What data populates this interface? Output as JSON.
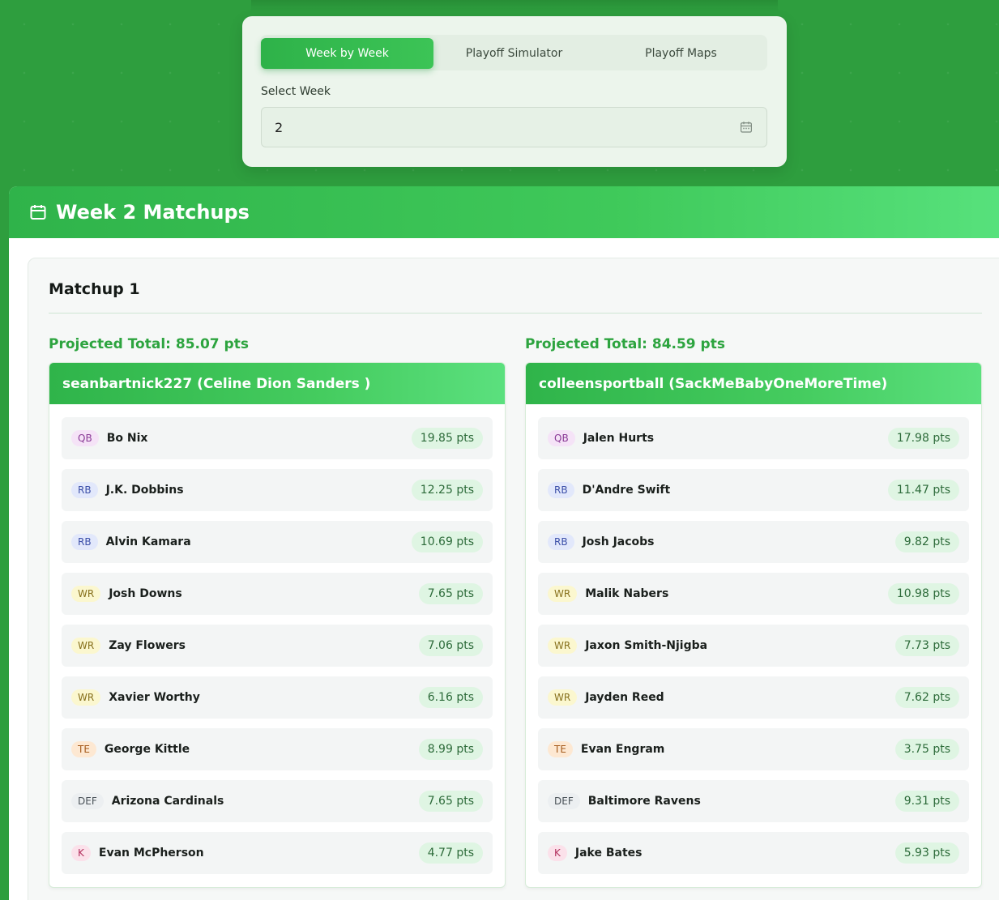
{
  "tabs": [
    {
      "label": "Week by Week",
      "active": true
    },
    {
      "label": "Playoff Simulator",
      "active": false
    },
    {
      "label": "Playoff Maps",
      "active": false
    }
  ],
  "week_select": {
    "label": "Select Week",
    "value": "2",
    "icon": "calendar-icon"
  },
  "panel": {
    "title": "Week 2 Matchups",
    "icon": "calendar-icon"
  },
  "matchup": {
    "title": "Matchup 1",
    "teams": [
      {
        "projected": "Projected Total: 85.07 pts",
        "name": "seanbartnick227 (Celine Dion Sanders )",
        "players": [
          {
            "pos": "QB",
            "name": "Bo Nix",
            "pts": "19.85 pts"
          },
          {
            "pos": "RB",
            "name": "J.K. Dobbins",
            "pts": "12.25 pts"
          },
          {
            "pos": "RB",
            "name": "Alvin Kamara",
            "pts": "10.69 pts"
          },
          {
            "pos": "WR",
            "name": "Josh Downs",
            "pts": "7.65 pts"
          },
          {
            "pos": "WR",
            "name": "Zay Flowers",
            "pts": "7.06 pts"
          },
          {
            "pos": "WR",
            "name": "Xavier Worthy",
            "pts": "6.16 pts"
          },
          {
            "pos": "TE",
            "name": "George Kittle",
            "pts": "8.99 pts"
          },
          {
            "pos": "DEF",
            "name": "Arizona Cardinals",
            "pts": "7.65 pts"
          },
          {
            "pos": "K",
            "name": "Evan McPherson",
            "pts": "4.77 pts"
          }
        ]
      },
      {
        "projected": "Projected Total: 84.59 pts",
        "name": "colleensportball (SackMeBabyOneMoreTime)",
        "players": [
          {
            "pos": "QB",
            "name": "Jalen Hurts",
            "pts": "17.98 pts"
          },
          {
            "pos": "RB",
            "name": "D'Andre Swift",
            "pts": "11.47 pts"
          },
          {
            "pos": "RB",
            "name": "Josh Jacobs",
            "pts": "9.82 pts"
          },
          {
            "pos": "WR",
            "name": "Malik Nabers",
            "pts": "10.98 pts"
          },
          {
            "pos": "WR",
            "name": "Jaxon Smith-Njigba",
            "pts": "7.73 pts"
          },
          {
            "pos": "WR",
            "name": "Jayden Reed",
            "pts": "7.62 pts"
          },
          {
            "pos": "TE",
            "name": "Evan Engram",
            "pts": "3.75 pts"
          },
          {
            "pos": "DEF",
            "name": "Baltimore Ravens",
            "pts": "9.31 pts"
          },
          {
            "pos": "K",
            "name": "Jake Bates",
            "pts": "5.93 pts"
          }
        ]
      }
    ]
  }
}
